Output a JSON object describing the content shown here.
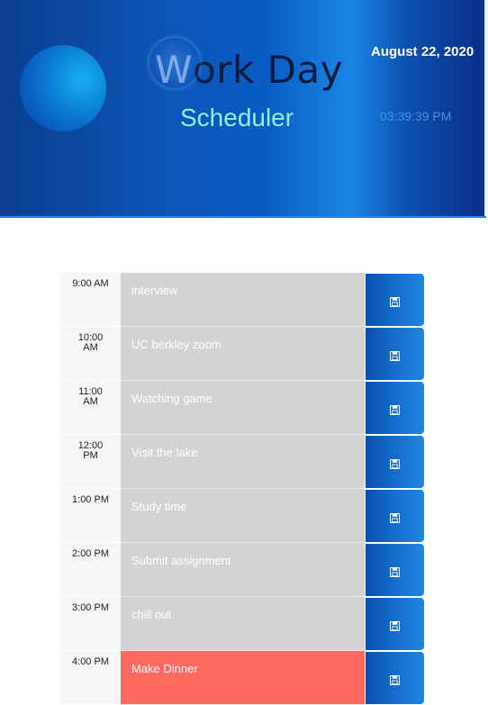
{
  "header": {
    "title_first_letter": "W",
    "title_rest": "ork Day",
    "subtitle": "Scheduler",
    "date": "August 22, 2020",
    "time": "03:39:39 PM"
  },
  "schedule": [
    {
      "hour_line1": "9:00 AM",
      "hour_line2": "",
      "task": "interview",
      "state": "past"
    },
    {
      "hour_line1": "10:00",
      "hour_line2": "AM",
      "task": "UC berkley zoom",
      "state": "past"
    },
    {
      "hour_line1": "11:00",
      "hour_line2": "AM",
      "task": "Watching game",
      "state": "past"
    },
    {
      "hour_line1": "12:00",
      "hour_line2": "PM",
      "task": "Visit the lake",
      "state": "past"
    },
    {
      "hour_line1": "1:00 PM",
      "hour_line2": "",
      "task": "Study time",
      "state": "past"
    },
    {
      "hour_line1": "2:00 PM",
      "hour_line2": "",
      "task": "Submit assignment",
      "state": "past"
    },
    {
      "hour_line1": "3:00 PM",
      "hour_line2": "",
      "task": "chill out",
      "state": "past"
    },
    {
      "hour_line1": "4:00 PM",
      "hour_line2": "",
      "task": "Make Dinner",
      "state": "present"
    }
  ],
  "colors": {
    "past": "#d3d3d3",
    "present": "#ff6961",
    "save_button": "#1a78d6"
  },
  "icons": {
    "save": "floppy-disk-icon"
  }
}
